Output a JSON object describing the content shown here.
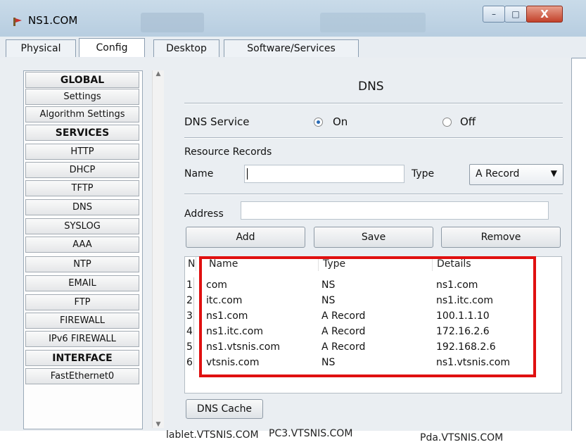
{
  "window": {
    "title": "NS1.COM",
    "min_glyph": "–",
    "max_glyph": "□",
    "close_glyph": "X"
  },
  "tabs": [
    {
      "label": "Physical"
    },
    {
      "label": "Config",
      "active": true
    },
    {
      "label": "Desktop"
    },
    {
      "label": "Software/Services"
    }
  ],
  "sidebar": {
    "items": [
      {
        "label": "GLOBAL",
        "header": true
      },
      {
        "label": "Settings"
      },
      {
        "label": "Algorithm Settings"
      },
      {
        "label": "SERVICES",
        "header": true
      },
      {
        "label": "HTTP"
      },
      {
        "label": "DHCP"
      },
      {
        "label": "TFTP"
      },
      {
        "label": "DNS"
      },
      {
        "label": "SYSLOG"
      },
      {
        "label": "AAA"
      },
      {
        "label": "NTP"
      },
      {
        "label": "EMAIL"
      },
      {
        "label": "FTP"
      },
      {
        "label": "FIREWALL"
      },
      {
        "label": "IPv6 FIREWALL"
      },
      {
        "label": "INTERFACE",
        "header": true
      },
      {
        "label": "FastEthernet0"
      }
    ]
  },
  "dns": {
    "title": "DNS",
    "service_label": "DNS Service",
    "on_label": "On",
    "off_label": "Off",
    "service_state": "On",
    "resource_records_label": "Resource Records",
    "name_label": "Name",
    "name_value": "",
    "type_label": "Type",
    "type_selected": "A Record",
    "address_label": "Address",
    "address_value": "",
    "add_label": "Add",
    "save_label": "Save",
    "remove_label": "Remove",
    "cache_label": "DNS Cache"
  },
  "records_table": {
    "headers": [
      "N",
      "Name",
      "Type",
      "Details"
    ],
    "rows": [
      {
        "no": "1",
        "name": "com",
        "type": "NS",
        "details": "ns1.com"
      },
      {
        "no": "2",
        "name": "itc.com",
        "type": "NS",
        "details": "ns1.itc.com"
      },
      {
        "no": "3",
        "name": "ns1.com",
        "type": "A Record",
        "details": "100.1.1.10"
      },
      {
        "no": "4",
        "name": "ns1.itc.com",
        "type": "A Record",
        "details": "172.16.2.6"
      },
      {
        "no": "5",
        "name": "ns1.vtsnis.com",
        "type": "A Record",
        "details": "192.168.2.6"
      },
      {
        "no": "6",
        "name": "vtsnis.com",
        "type": "NS",
        "details": "ns1.vtsnis.com"
      }
    ]
  },
  "background_labels": {
    "tablet": "lablet.VTSNIS.COM",
    "pc3": "PC3.VTSNIS.COM",
    "pda": "Pda.VTSNIS.COM"
  },
  "colors": {
    "highlight": "#e01010",
    "radio_dot": "#2a6bb5",
    "close_button": "#c2412a"
  }
}
